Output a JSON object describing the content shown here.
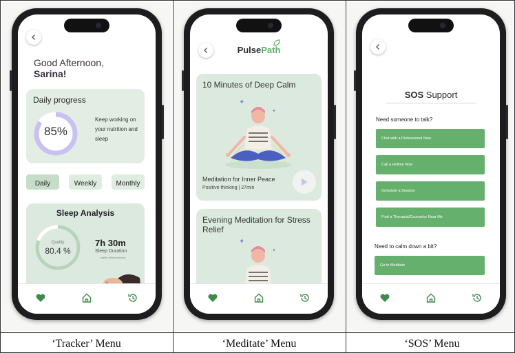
{
  "captions": [
    "‘Tracker’ Menu",
    "‘Meditate’ Menu",
    "‘SOS’ Menu"
  ],
  "colors": {
    "accent": "#66b06e",
    "card": "#dbe9df",
    "ring": "#c9c1f2"
  },
  "tracker": {
    "greeting_line1": "Good Afternoon,",
    "greeting_name": "Sarina!",
    "daily_progress_title": "Daily progress",
    "progress_value": "85%",
    "progress_fraction": 0.85,
    "progress_message": "Keep working on your nutrition and sleep",
    "periods": [
      "Daily",
      "Weekly",
      "Monthly"
    ],
    "active_period": "Daily",
    "sleep_title": "Sleep Analysis",
    "sleep_quality_label": "Quality",
    "sleep_quality_value": "80.4 %",
    "sleep_quality_fraction": 0.804,
    "sleep_duration_value": "7h 30m",
    "sleep_duration_label": "Sleep Duration",
    "sleep_duration_note": "stable within window"
  },
  "meditate": {
    "brand_part1": "Pulse",
    "brand_part2": "Path",
    "cards": [
      {
        "title": "10 Minutes of Deep Calm",
        "subtitle": "Meditation for Inner Peace",
        "meta": "Positive thinking | 27min"
      },
      {
        "title": "Evening Meditation for Stress Relief"
      }
    ]
  },
  "sos": {
    "title_bold": "SOS",
    "title_rest": " Support",
    "question_talk": "Need someone to talk?",
    "talk_buttons": [
      "Chat with a Professional Now",
      "Call a Hotline Now",
      "Schedule a Session",
      "Find a Therapist/Counselor Near Me"
    ],
    "question_calm": "Need to calm down a bit?",
    "calm_button": "Go to Meditate"
  },
  "tabbar": {
    "icons": [
      "heart-icon",
      "home-icon",
      "history-icon"
    ],
    "active": "heart-icon"
  }
}
